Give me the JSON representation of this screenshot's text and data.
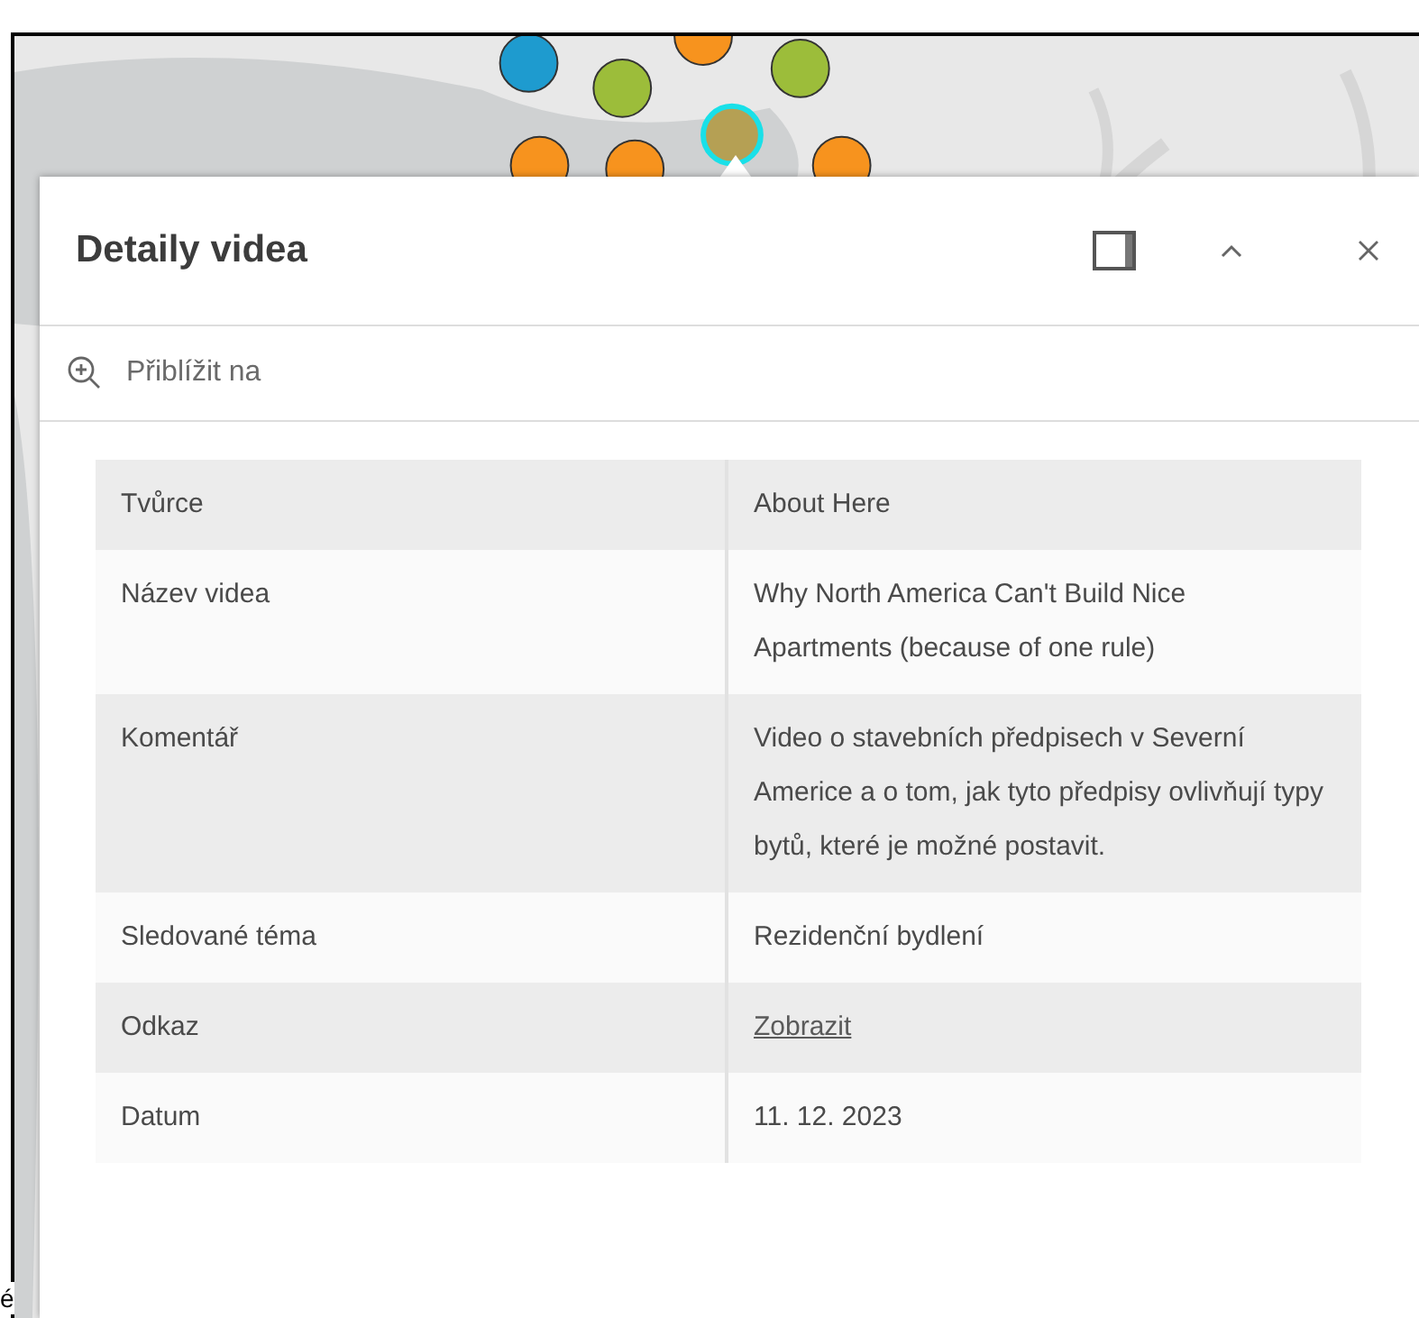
{
  "popup": {
    "title": "Detaily videa",
    "zoom_action": "Přiblížit na",
    "rows": [
      {
        "label": "Tvůrce",
        "value": "About Here",
        "kind": "text"
      },
      {
        "label": "Název videa",
        "value": "Why North America Can't Build Nice Apartments (because of one rule)",
        "kind": "text"
      },
      {
        "label": "Komentář",
        "value": "Video o stavebních předpisech v Severní Americe a o tom, jak tyto předpisy ovlivňují typy bytů, které je možné postavit.",
        "kind": "text"
      },
      {
        "label": "Sledované téma",
        "value": "Rezidenční bydlení",
        "kind": "text"
      },
      {
        "label": "Odkaz",
        "value": "Zobrazit",
        "kind": "link"
      },
      {
        "label": "Datum",
        "value": "11. 12. 2023",
        "kind": "text"
      }
    ]
  },
  "page_fragment": "é"
}
